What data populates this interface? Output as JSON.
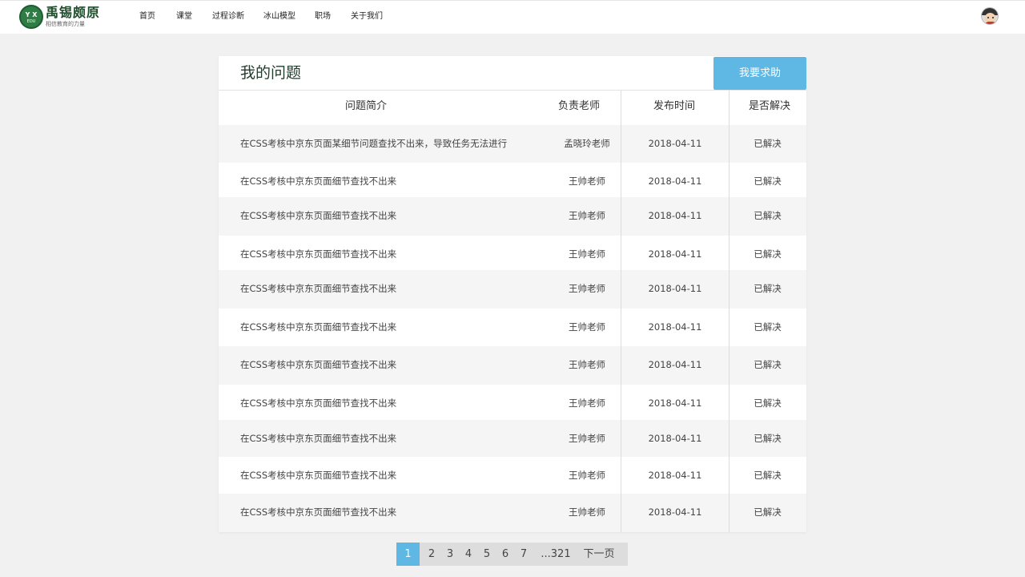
{
  "header": {
    "logo": {
      "badge_top": "Y X",
      "badge_bottom": "EDU",
      "name": "禹锡颇原",
      "slogan": "相信教育的力量"
    },
    "nav": [
      "首页",
      "课堂",
      "过程诊断",
      "冰山模型",
      "职场",
      "关于我们"
    ],
    "avatar": "user-avatar"
  },
  "main": {
    "title": "我的问题",
    "help_button": "我要求助",
    "columns": [
      "问题简介",
      "负责老师",
      "发布时间",
      "是否解决"
    ],
    "rows": [
      {
        "desc": "在CSS考核中京东页面某细节问题查找不出来，导致任务无法进行",
        "teacher": "孟晓玲老师",
        "date": "2018-04-11",
        "status": "已解决"
      },
      {
        "desc": "在CSS考核中京东页面细节查找不出来",
        "teacher": "王帅老师",
        "date": "2018-04-11",
        "status": "已解决"
      },
      {
        "desc": "在CSS考核中京东页面细节查找不出来",
        "teacher": "王帅老师",
        "date": "2018-04-11",
        "status": "已解决"
      },
      {
        "desc": "在CSS考核中京东页面细节查找不出来",
        "teacher": "王帅老师",
        "date": "2018-04-11",
        "status": "已解决"
      },
      {
        "desc": "在CSS考核中京东页面细节查找不出来",
        "teacher": "王帅老师",
        "date": "2018-04-11",
        "status": "已解决"
      },
      {
        "desc": "在CSS考核中京东页面细节查找不出来",
        "teacher": "王帅老师",
        "date": "2018-04-11",
        "status": "已解决"
      },
      {
        "desc": "在CSS考核中京东页面细节查找不出来",
        "teacher": "王帅老师",
        "date": "2018-04-11",
        "status": "已解决"
      },
      {
        "desc": "在CSS考核中京东页面细节查找不出来",
        "teacher": "王帅老师",
        "date": "2018-04-11",
        "status": "已解决"
      },
      {
        "desc": "在CSS考核中京东页面细节查找不出来",
        "teacher": "王帅老师",
        "date": "2018-04-11",
        "status": "已解决"
      },
      {
        "desc": "在CSS考核中京东页面细节查找不出来",
        "teacher": "王帅老师",
        "date": "2018-04-11",
        "status": "已解决"
      },
      {
        "desc": "在CSS考核中京东页面细节查找不出来",
        "teacher": "王帅老师",
        "date": "2018-04-11",
        "status": "已解决"
      }
    ]
  },
  "pagination": {
    "pages": [
      "1",
      "2",
      "3",
      "4",
      "5",
      "6",
      "7",
      "...321"
    ],
    "next": "下一页",
    "active": "1"
  },
  "colors": {
    "accent": "#5fb8e4",
    "brand_green": "#2f7d45",
    "row_alt": "#f5f5f5",
    "page_bg": "#f1f1f1"
  }
}
